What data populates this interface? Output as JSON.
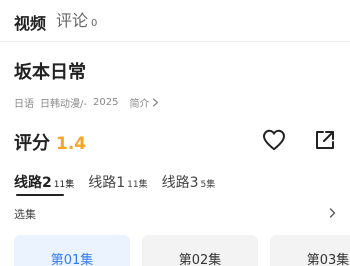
{
  "tabs": [
    {
      "label": "视频",
      "active": true
    },
    {
      "label": "评论",
      "count": "0",
      "active": false
    }
  ],
  "title": "坂本日常",
  "meta": {
    "language": "日语",
    "category": "日韩动漫/-",
    "year": "2025",
    "intro_label": "简介"
  },
  "rating": {
    "label": "评分",
    "value": "1.4",
    "value_color": "#f5a623"
  },
  "icons": {
    "favorite": "heart-icon",
    "share": "share-external-icon",
    "chevron": "chevron-right-icon"
  },
  "lines": [
    {
      "label": "线路2",
      "count": "11集",
      "active": true
    },
    {
      "label": "线路1",
      "count": "11集",
      "active": false
    },
    {
      "label": "线路3",
      "count": "5集",
      "active": false
    }
  ],
  "episodes_section": {
    "label": "选集"
  },
  "episodes": [
    {
      "label": "第01集",
      "active": true
    },
    {
      "label": "第02集",
      "active": false
    },
    {
      "label": "第03集",
      "active": false
    }
  ],
  "colors": {
    "accent_blue": "#2e7cf6",
    "active_chip_bg": "#eaf3ff",
    "chip_bg": "#f3f3f3",
    "rating_orange": "#f5a623"
  }
}
